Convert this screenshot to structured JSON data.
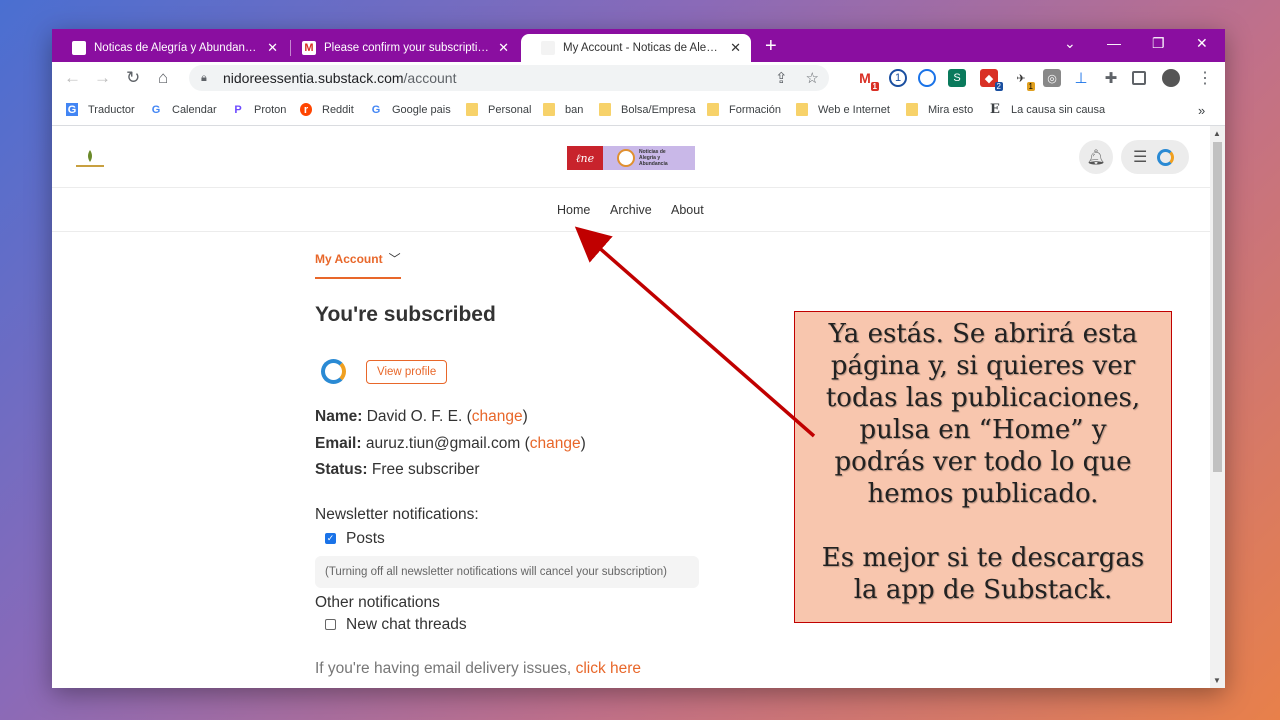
{
  "tabs": [
    {
      "label": "Noticas de Alegría y Abundancia | D",
      "active": false
    },
    {
      "label": "Please confirm your subscription - a",
      "active": false
    },
    {
      "label": "My Account - Noticas de Alegría y A",
      "active": true
    }
  ],
  "address": {
    "host": "nidoreessentia.substack.com",
    "path": "/account"
  },
  "bookmarks": [
    "Traductor",
    "Calendar",
    "Proton",
    "Reddit",
    "Google pais",
    "Personal",
    "ban",
    "Bolsa/Empresa",
    "Formación",
    "Web e Internet",
    "Mira esto",
    "La causa sin causa"
  ],
  "extensions": {
    "gmail_badge": "1",
    "ext2_badge": "2",
    "ext3_badge": "1"
  },
  "nav": {
    "home": "Home",
    "archive": "Archive",
    "about": "About"
  },
  "account": {
    "tab_label": "My Account",
    "heading": "You're subscribed",
    "view_profile": "View profile",
    "name_label": "Name:",
    "name_value": "David O. F. E.",
    "email_label": "Email:",
    "email_value": "auruz.tiun@gmail.com",
    "change": "change",
    "status_label": "Status:",
    "status_value": "Free subscriber",
    "newsletter_title": "Newsletter notifications:",
    "posts_label": "Posts",
    "posts_checked": true,
    "note": "(Turning off all newsletter notifications will cancel your subscription)",
    "other_title": "Other notifications",
    "chat_label": "New chat threads",
    "chat_checked": false,
    "email_issue_text": "If you're having email delivery issues,",
    "click_here": "click here"
  },
  "callout": {
    "lines": [
      "Ya estás. Se abrirá esta",
      "página y, si quieres ver",
      "todas las publicaciones,",
      "pulsa en “Home” y",
      "podrás ver todo lo que",
      "hemos publicado."
    ],
    "lines2": [
      "Es mejor si te descargas",
      "la app de Substack."
    ]
  },
  "colors": {
    "tab_bar": "#8a0ea0",
    "accent": "#e8672a",
    "callout_bg": "#f8c6ae",
    "arrow": "#c00000"
  }
}
